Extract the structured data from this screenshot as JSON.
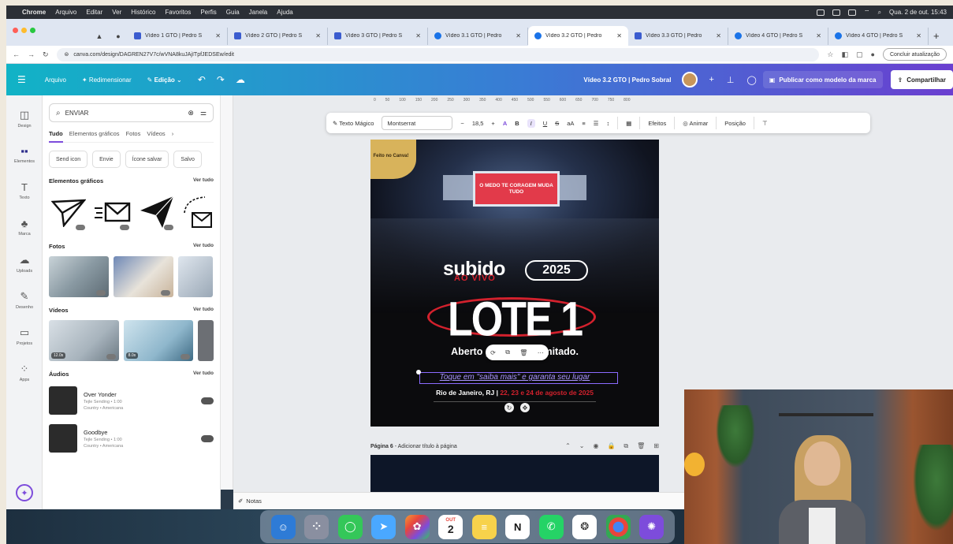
{
  "menubar": {
    "items": [
      "Chrome",
      "Arquivo",
      "Editar",
      "Ver",
      "Histórico",
      "Favoritos",
      "Perfis",
      "Guia",
      "Janela",
      "Ajuda"
    ],
    "clock": "Qua. 2 de out. 15:43"
  },
  "browser": {
    "tabs": [
      {
        "label": "Vídeo 1 GTO | Pedro S"
      },
      {
        "label": "Vídeo 2 GTO | Pedro S"
      },
      {
        "label": "Vídeo 3 GTO | Pedro S"
      },
      {
        "label": "Vídeo 3.1 GTO | Pedro"
      },
      {
        "label": "Vídeo 3.2 GTO | Pedro"
      },
      {
        "label": "Vídeo 3.3 GTO | Pedro"
      },
      {
        "label": "Vídeo 4 GTO | Pedro S"
      },
      {
        "label": "Vídeo 4 GTO | Pedro S"
      }
    ],
    "active_tab": 4,
    "url": "canva.com/design/DAGREN27V7c/wVNA8kuJAjITpfJEDSEw/edit",
    "finish_update": "Concluir atualização"
  },
  "canva_header": {
    "menu_file": "Arquivo",
    "menu_resize": "Redimensionar",
    "menu_edit": "Edição",
    "doc_title": "Vídeo 3.2 GTO | Pedro Sobral",
    "publish": "Publicar como modelo da marca",
    "share": "Compartilhar"
  },
  "rail": {
    "items": [
      {
        "label": "Design",
        "icon": "layout-icon"
      },
      {
        "label": "Elementos",
        "icon": "elements-icon"
      },
      {
        "label": "Texto",
        "icon": "text-icon"
      },
      {
        "label": "Marca",
        "icon": "brand-icon"
      },
      {
        "label": "Uploads",
        "icon": "cloud-upload-icon"
      },
      {
        "label": "Desenho",
        "icon": "draw-icon"
      },
      {
        "label": "Projetos",
        "icon": "folder-icon"
      },
      {
        "label": "Apps",
        "icon": "apps-icon"
      }
    ]
  },
  "panel": {
    "search_value": "ENVIAR",
    "tabs": [
      "Tudo",
      "Elementos gráficos",
      "Fotos",
      "Vídeos"
    ],
    "chips": [
      "Send icon",
      "Envie",
      "Ícone salvar",
      "Salvo"
    ],
    "sections": {
      "graphics": "Elementos gráficos",
      "photos": "Fotos",
      "videos": "Vídeos",
      "audios": "Áudios",
      "see_all": "Ver tudo"
    },
    "videos": [
      {
        "duration": "12.0s"
      },
      {
        "duration": "8.0s"
      }
    ],
    "audios": [
      {
        "title": "Over Yonder",
        "artist": "Tejle Sending • 1:00",
        "genre": "Country • Americana"
      },
      {
        "title": "Goodbye",
        "artist": "Tejle Sending • 1:00",
        "genre": "Country • Americana"
      }
    ]
  },
  "ruler": {
    "ticks": [
      "0",
      "50",
      "100",
      "150",
      "200",
      "250",
      "300",
      "350",
      "400",
      "450",
      "500",
      "550",
      "600",
      "650",
      "700",
      "750",
      "800"
    ]
  },
  "toolbar": {
    "magic_text": "Texto Mágico",
    "font": "Montserrat",
    "size": "18,5",
    "effects": "Efeitos",
    "animate": "Animar",
    "position": "Posição"
  },
  "design": {
    "badge": "Feito no Canva!",
    "stage_screen": "O MEDO TE CORAGEM MUDA TUDO",
    "brand": "subido",
    "brand_sub": "AO VIVO",
    "year": "2025",
    "lote": "LOTE 1",
    "aberto_pre": "Aberto p",
    "aberto_post": "mitado.",
    "saiba": "Toque em \"saiba mais\" e garanta seu lugar",
    "local_city": "Rio de Janeiro, RJ | ",
    "local_dates": "22, 23 e 24 de agosto de 2025"
  },
  "page6": {
    "label": "Página 6",
    "add_title": "Adicionar título à página"
  },
  "notes": {
    "label": "Notas"
  },
  "dock": {
    "apps": [
      {
        "name": "finder-icon",
        "color": "#2e7bd6"
      },
      {
        "name": "launchpad-icon",
        "color": "#8a8fa0"
      },
      {
        "name": "messages-icon",
        "color": "#34c759"
      },
      {
        "name": "maps-icon",
        "color": "#4aa8ff"
      },
      {
        "name": "photos-icon",
        "color": "#f29b34"
      },
      {
        "name": "calendar-icon",
        "color": "#ffffff"
      },
      {
        "name": "notes-icon",
        "color": "#f7d24b"
      },
      {
        "name": "notion-icon",
        "color": "#ffffff"
      },
      {
        "name": "whatsapp-icon",
        "color": "#25d366"
      },
      {
        "name": "chatgpt-icon",
        "color": "#ffffff"
      },
      {
        "name": "chrome-icon",
        "color": "#e8453c"
      },
      {
        "name": "canva-icon",
        "color": "#7d4cdb"
      }
    ],
    "calendar_month": "OUT",
    "calendar_day": "2",
    "notion_letter": "N"
  }
}
